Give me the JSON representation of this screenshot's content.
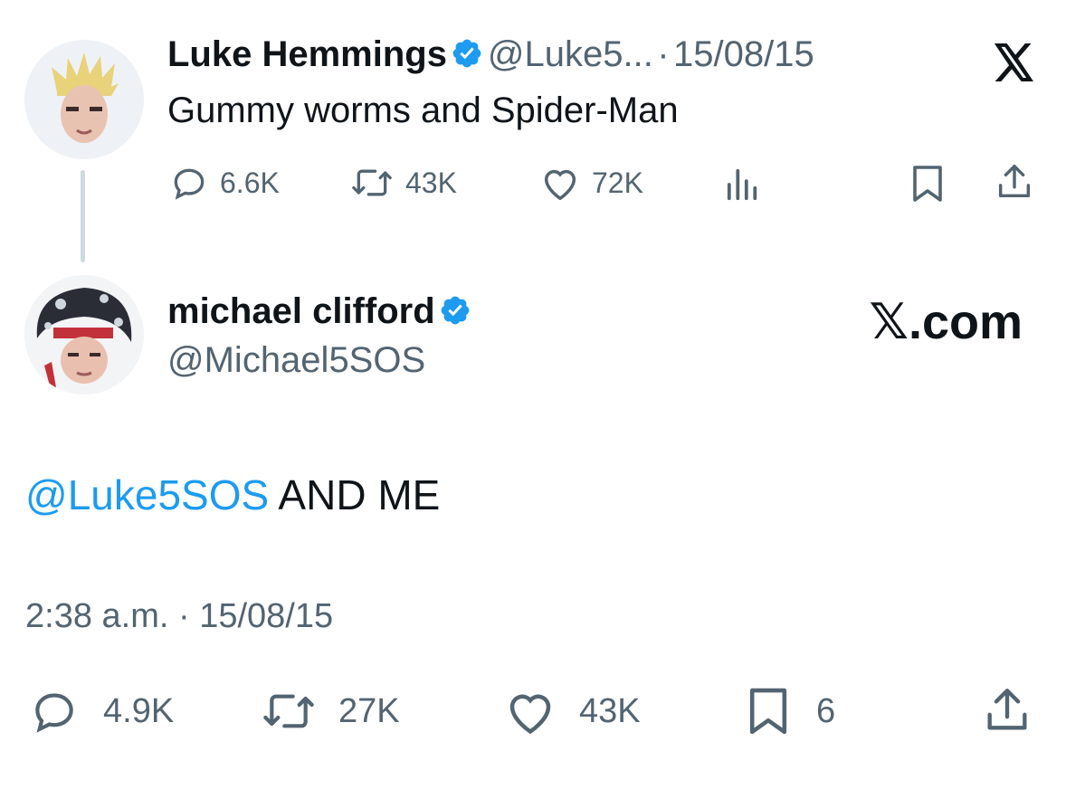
{
  "quoted_tweet": {
    "author_name": "Luke Hemmings",
    "handle": "@Luke5...",
    "separator": "·",
    "date": "15/08/15",
    "text": "Gummy worms and Spider-Man",
    "metrics": {
      "replies": "6.6K",
      "retweets": "43K",
      "likes": "72K"
    },
    "logo_icon": "x-logo-icon"
  },
  "main_tweet": {
    "author_name": "michael clifford",
    "handle": "@Michael5SOS",
    "brand_text": "𝕏.com",
    "mention": "@Luke5SOS",
    "body": " AND ME",
    "time": "2:38 a.m.",
    "separator": "·",
    "date": "15/08/15",
    "metrics": {
      "replies": "4.9K",
      "retweets": "27K",
      "likes": "43K",
      "bookmarks": "6"
    }
  },
  "colors": {
    "verified": "#1d9bf0",
    "link": "#1d9bf0",
    "secondary": "#536471"
  }
}
